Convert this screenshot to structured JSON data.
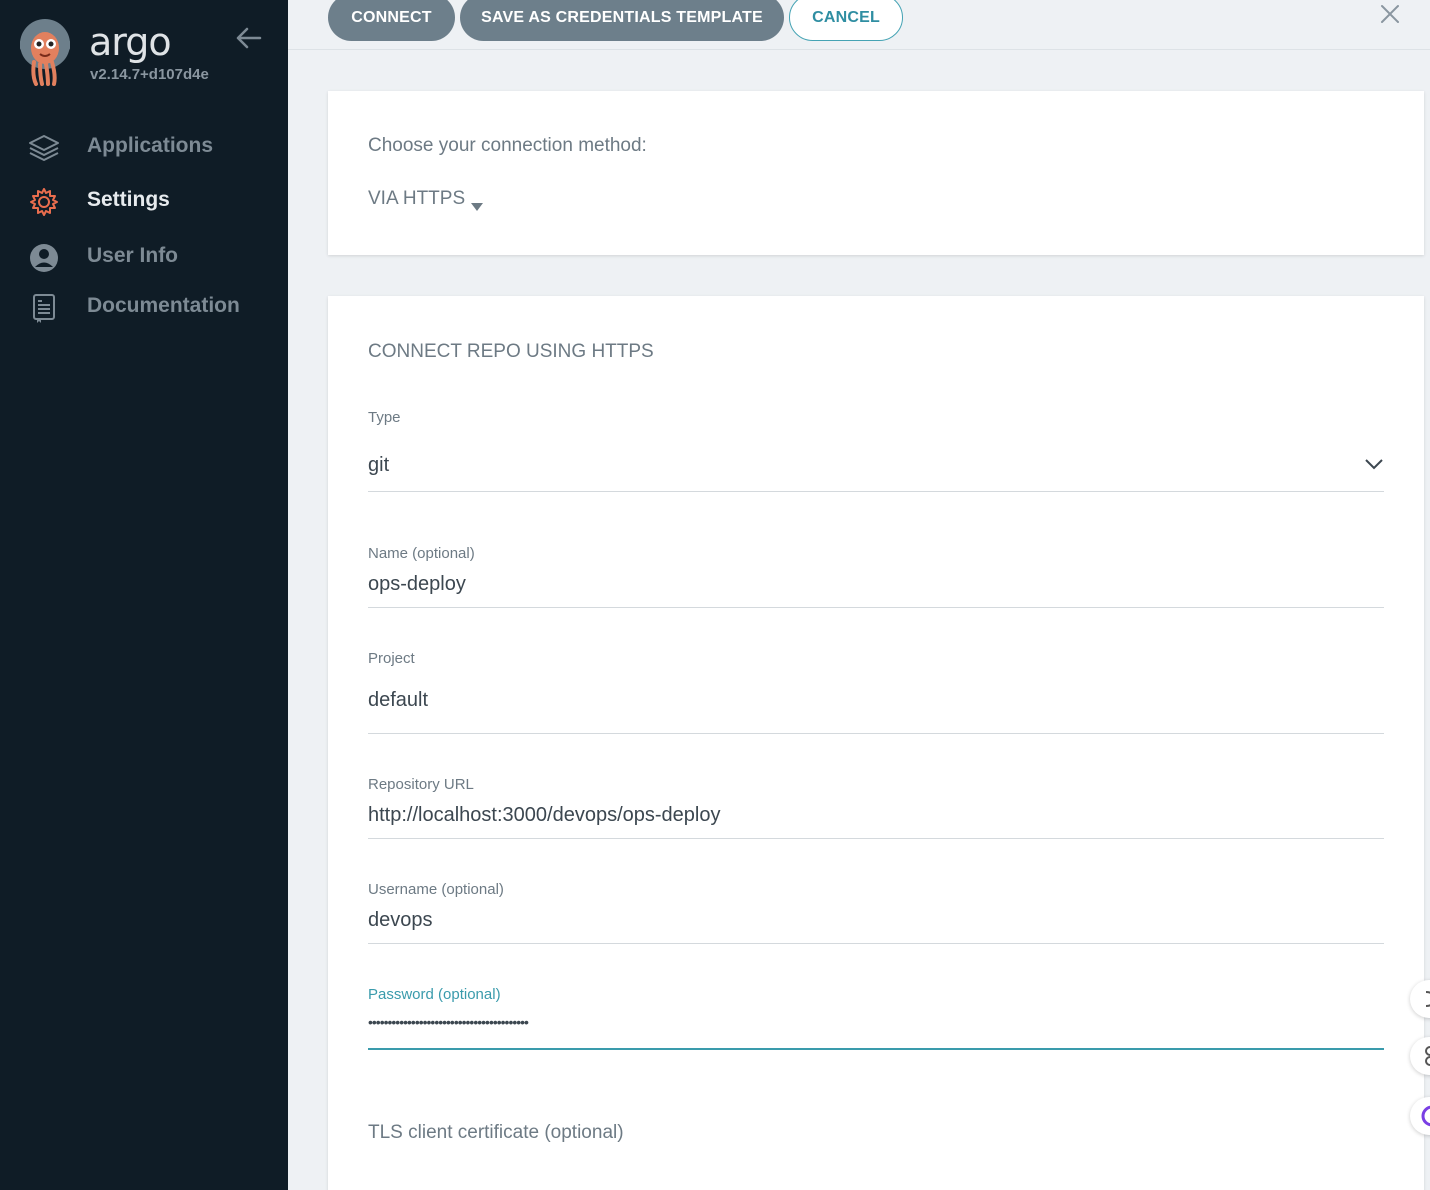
{
  "sidebar": {
    "brand": "argo",
    "version": "v2.14.7+d107d4e",
    "items": [
      {
        "label": "Applications",
        "icon": "layers-icon"
      },
      {
        "label": "Settings",
        "icon": "gear-icon"
      },
      {
        "label": "User Info",
        "icon": "user-icon"
      },
      {
        "label": "Documentation",
        "icon": "book-icon"
      }
    ],
    "active_item": "Settings",
    "active_color": "#e96d4e"
  },
  "toolbar": {
    "connect_label": "CONNECT",
    "save_template_label": "SAVE AS CREDENTIALS TEMPLATE",
    "cancel_label": "CANCEL"
  },
  "connection": {
    "prompt": "Choose your connection method:",
    "method": "VIA HTTPS"
  },
  "form": {
    "title": "CONNECT REPO USING HTTPS",
    "type": {
      "label": "Type",
      "value": "git"
    },
    "name": {
      "label": "Name (optional)",
      "value": "ops-deploy"
    },
    "project": {
      "label": "Project",
      "value": "default"
    },
    "repo_url": {
      "label": "Repository URL",
      "value": "http://localhost:3000/devops/ops-deploy"
    },
    "username": {
      "label": "Username (optional)",
      "value": "devops"
    },
    "password": {
      "label": "Password (optional)",
      "value": "•••••••••••••••••••••••••••••••••••••••••"
    },
    "tls_title": "TLS client certificate (optional)"
  },
  "colors": {
    "sidebar_bg": "#0f1c26",
    "accent": "#3a9bac",
    "primary_button": "#6d7f8b"
  }
}
